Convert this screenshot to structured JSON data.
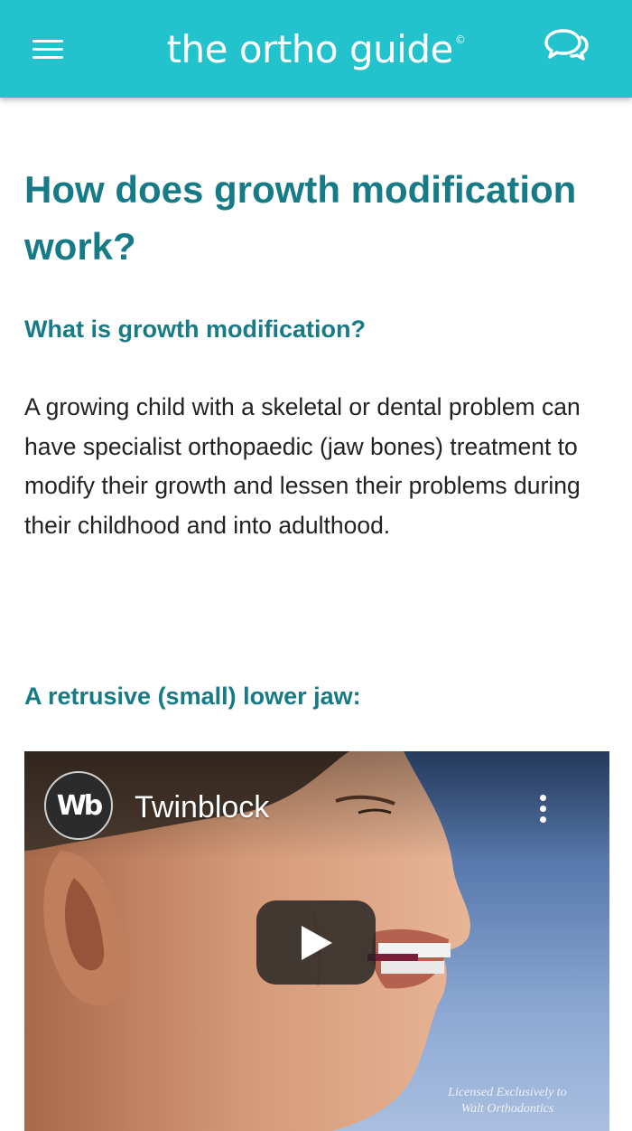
{
  "header": {
    "brand": "the ortho guide",
    "brand_mark": "©",
    "menu_icon": "hamburger-menu-icon",
    "chat_icon": "chat-bubbles-icon",
    "bg_color": "#22c3cc"
  },
  "article": {
    "title": "How does growth modification work?",
    "section_heading": "What is growth modification?",
    "paragraph": "A growing child with a skeletal or dental problem can have specialist orthopaedic (jaw bones) treatment to modify their growth and lessen their problems during their childhood and into adulthood.",
    "subheading": "A retrusive (small) lower jaw:",
    "heading_color": "#167b86"
  },
  "video": {
    "channel_logo_text": "Wb",
    "title": "Twinblock",
    "more_icon": "more-vertical-icon",
    "play_icon": "play-icon",
    "watermark_line1": "Licensed Exclusively to",
    "watermark_line2": "Walt Orthodontics"
  }
}
